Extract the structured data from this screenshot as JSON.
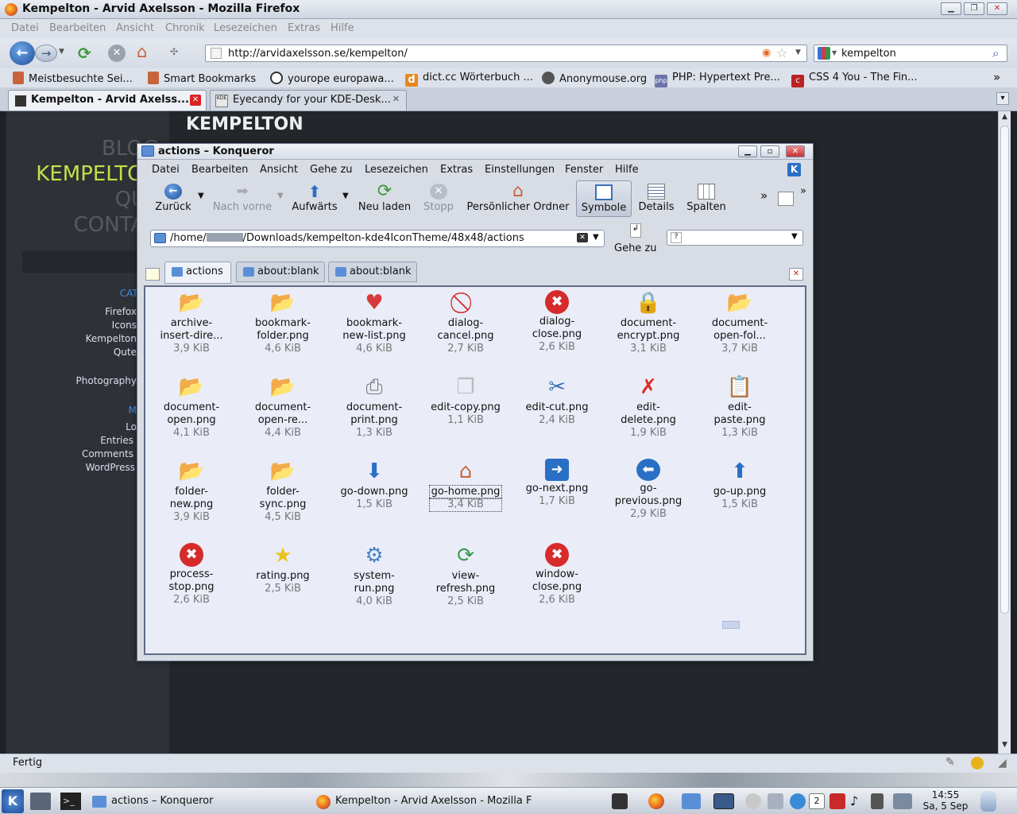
{
  "firefox": {
    "title": "Kempelton - Arvid Axelsson - Mozilla Firefox",
    "menu": [
      "Datei",
      "Bearbeiten",
      "Ansicht",
      "Chronik",
      "Lesezeichen",
      "Extras",
      "Hilfe"
    ],
    "url": "http://arvidaxelsson.se/kempelton/",
    "search": "kempelton",
    "bookmarks": [
      "Meistbesuchte Sei...",
      "Smart Bookmarks",
      "yourope europawa...",
      "dict.cc Wörterbuch ...",
      "Anonymouse.org",
      "PHP: Hypertext Pre...",
      "CSS 4 You - The Fin..."
    ],
    "bookmarks_more": "»",
    "tabs": [
      {
        "label": "Kempelton - Arvid Axelss..."
      },
      {
        "label": "Eyecandy for your KDE-Desk..."
      }
    ],
    "status": "Fertig"
  },
  "webpage": {
    "nav": [
      "BLOG",
      "KEMPELTON",
      "QUT",
      "CONTAC"
    ],
    "heading": "KEMPELTON",
    "categories_title": "CATEGO",
    "categories": [
      "Firefox",
      "Icons",
      "Kempelton",
      "Qute",
      "Photography"
    ],
    "meta_title": "M",
    "meta": [
      "Lo",
      "Entries",
      "Comments",
      "WordPress"
    ]
  },
  "konqueror": {
    "title": "actions – Konqueror",
    "menu": [
      "Datei",
      "Bearbeiten",
      "Ansicht",
      "Gehe zu",
      "Lesezeichen",
      "Extras",
      "Einstellungen",
      "Fenster",
      "Hilfe"
    ],
    "toolbar": [
      "Zurück",
      "Nach vorne",
      "Aufwärts",
      "Neu laden",
      "Stopp",
      "Persönlicher Ordner",
      "Symbole",
      "Details",
      "Spalten"
    ],
    "toolbar_more": "»",
    "location_prefix": "/home/",
    "location_suffix": "/Downloads/kempelton-kde4IconTheme/48x48/actions",
    "goto_label": "Gehe zu",
    "tabs": [
      "actions",
      "about:blank",
      "about:blank"
    ],
    "files": [
      {
        "name": "archive-\ninsert-dire...",
        "size": "3,9 KiB",
        "icon": "folder-star-icon",
        "color": "#3b7fd6"
      },
      {
        "name": "bookmark-\nfolder.png",
        "size": "4,6 KiB",
        "icon": "folder-heart-icon",
        "color": "#d63b3b"
      },
      {
        "name": "bookmark-\nnew-list.png",
        "size": "4,6 KiB",
        "icon": "heart-list-icon",
        "color": "#d63b3b"
      },
      {
        "name": "dialog-\ncancel.png",
        "size": "2,7 KiB",
        "icon": "cancel-icon",
        "color": "#d62b2b"
      },
      {
        "name": "dialog-\nclose.png",
        "size": "2,6 KiB",
        "icon": "close-icon",
        "color": "#d62b2b"
      },
      {
        "name": "document-\nencrypt.png",
        "size": "3,1 KiB",
        "icon": "lock-icon",
        "color": "#c79a1e"
      },
      {
        "name": "document-\nopen-fol...",
        "size": "3,7 KiB",
        "icon": "folder-open-icon",
        "color": "#3b7fd6"
      },
      {
        "name": "document-\nopen.png",
        "size": "4,1 KiB",
        "icon": "folder-open-icon",
        "color": "#3b7fd6"
      },
      {
        "name": "document-\nopen-re...",
        "size": "4,4 KiB",
        "icon": "folder-globe-icon",
        "color": "#3b7fd6"
      },
      {
        "name": "document-\nprint.png",
        "size": "1,3 KiB",
        "icon": "printer-icon",
        "color": "#777777"
      },
      {
        "name": "edit-copy.png",
        "size": "1,1 KiB",
        "icon": "copy-icon",
        "color": "#bbbbbb"
      },
      {
        "name": "edit-cut.png",
        "size": "2,4 KiB",
        "icon": "scissors-icon",
        "color": "#3b6fb6"
      },
      {
        "name": "edit-\ndelete.png",
        "size": "1,9 KiB",
        "icon": "delete-x-icon",
        "color": "#e02a2a"
      },
      {
        "name": "edit-\npaste.png",
        "size": "1,3 KiB",
        "icon": "clipboard-icon",
        "color": "#9a6a4a"
      },
      {
        "name": "folder-\nnew.png",
        "size": "3,9 KiB",
        "icon": "folder-star-icon",
        "color": "#3b7fd6"
      },
      {
        "name": "folder-\nsync.png",
        "size": "4,5 KiB",
        "icon": "folder-sync-icon",
        "color": "#3b9a4a"
      },
      {
        "name": "go-down.png",
        "size": "1,5 KiB",
        "icon": "arrow-down-icon",
        "color": "#2a6fc6"
      },
      {
        "name": "go-home.png",
        "size": "3,4 KiB",
        "icon": "home-icon",
        "color": "#c8643c"
      },
      {
        "name": "go-next.png",
        "size": "1,7 KiB",
        "icon": "arrow-right-icon",
        "color": "#2a6fc6"
      },
      {
        "name": "go-\nprevious.png",
        "size": "2,9 KiB",
        "icon": "arrow-left-icon",
        "color": "#2a6fc6"
      },
      {
        "name": "go-up.png",
        "size": "1,5 KiB",
        "icon": "arrow-up-icon",
        "color": "#2a6fc6"
      },
      {
        "name": "process-\nstop.png",
        "size": "2,6 KiB",
        "icon": "stop-icon",
        "color": "#d62b2b"
      },
      {
        "name": "rating.png",
        "size": "2,5 KiB",
        "icon": "star-icon",
        "color": "#e8c21e"
      },
      {
        "name": "system-\nrun.png",
        "size": "4,0 KiB",
        "icon": "gear-icon",
        "color": "#4a7fc6"
      },
      {
        "name": "view-\nrefresh.png",
        "size": "2,5 KiB",
        "icon": "refresh-icon",
        "color": "#3b9a4a"
      },
      {
        "name": "window-\nclose.png",
        "size": "2,6 KiB",
        "icon": "close-icon",
        "color": "#d62b2b"
      }
    ],
    "selected_file": "go-home.png"
  },
  "panel": {
    "tasks": [
      "actions – Konqueror",
      "Kempelton - Arvid Axelsson - Mozilla F"
    ],
    "clock_time": "14:55",
    "clock_date": "Sa, 5 Sep",
    "desktop_number": "2"
  }
}
